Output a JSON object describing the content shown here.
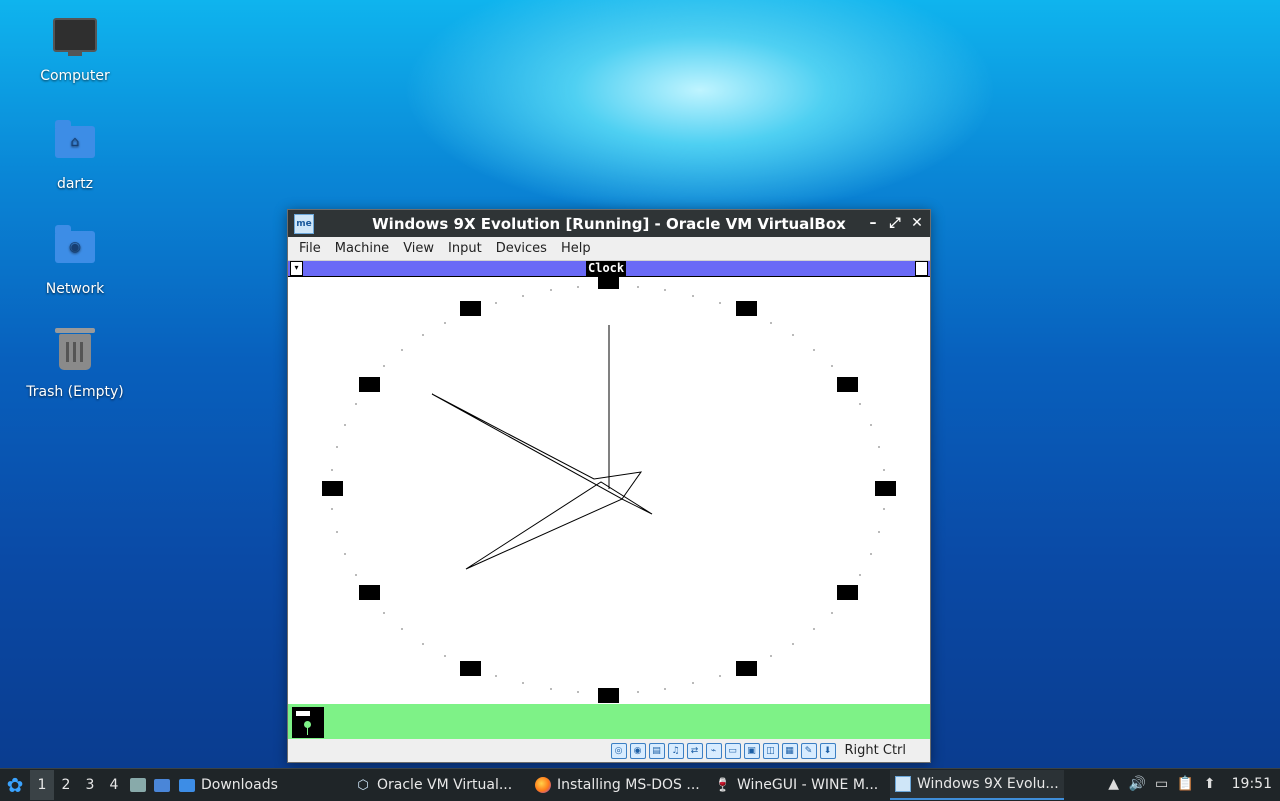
{
  "desktop": {
    "icons": [
      {
        "label": "Computer"
      },
      {
        "label": "dartz"
      },
      {
        "label": "Network"
      },
      {
        "label": "Trash (Empty)"
      }
    ]
  },
  "vbox": {
    "title": "Windows 9X Evolution [Running] - Oracle VM VirtualBox",
    "menu": [
      "File",
      "Machine",
      "View",
      "Input",
      "Devices",
      "Help"
    ],
    "status_host_key": "Right Ctrl"
  },
  "guest": {
    "clock_window_title": "Clock",
    "colors": {
      "caption": "#6a6af6",
      "taskbar": "#7ef287"
    }
  },
  "taskbar": {
    "workspaces": [
      "1",
      "2",
      "3",
      "4"
    ],
    "active_workspace": "1",
    "tasks": [
      {
        "label": "Downloads",
        "icon": "folder-icon"
      },
      {
        "label": "Oracle VM Virtual...",
        "icon": "virtualbox-icon"
      },
      {
        "label": "Installing MS-DOS ...",
        "icon": "firefox-icon"
      },
      {
        "label": "WineGUI - WINE M...",
        "icon": "wine-icon"
      },
      {
        "label": "Windows 9X Evolu...",
        "icon": "virtualbox-vm-icon",
        "active": true
      }
    ],
    "clock": "19:51"
  }
}
